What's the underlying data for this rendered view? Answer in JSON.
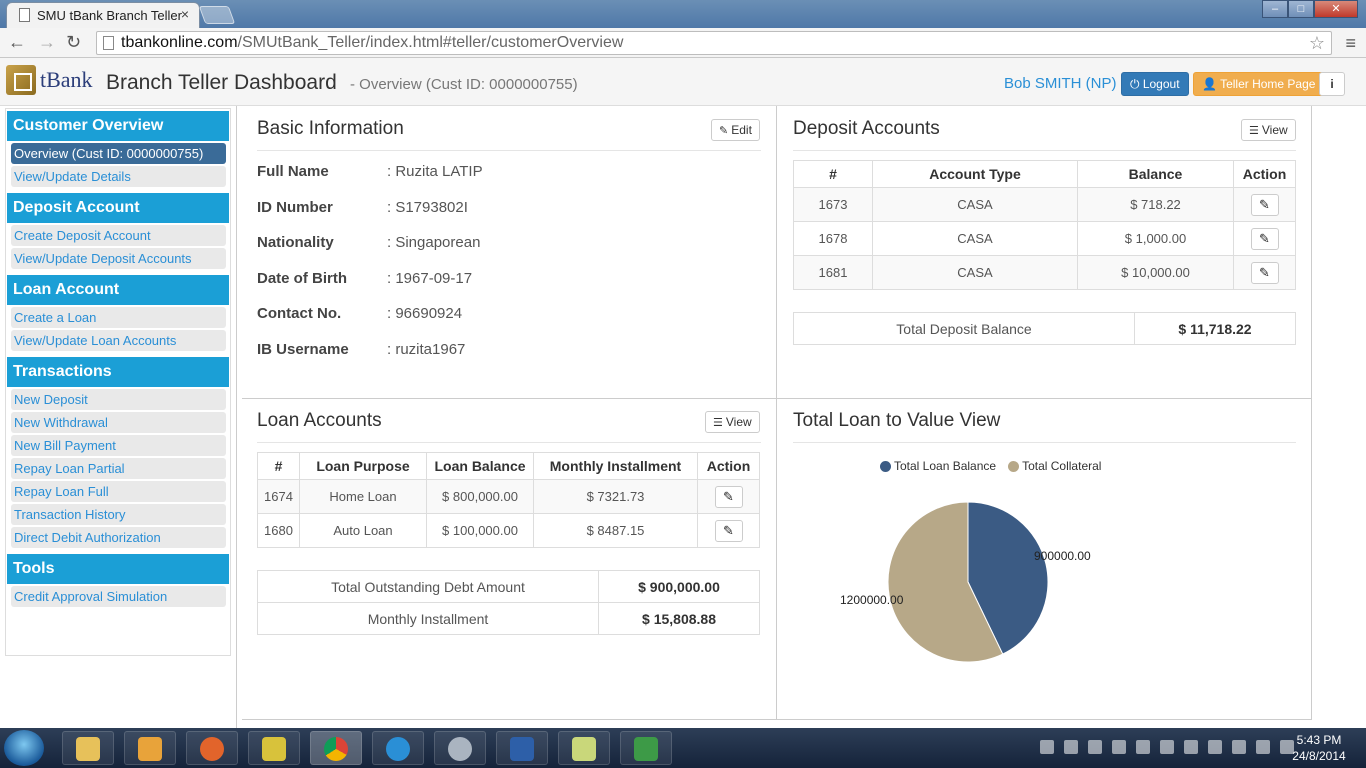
{
  "browser": {
    "tab_title": "SMU tBank Branch Teller",
    "tab_close": "×",
    "url_host": "tbankonline.com",
    "url_path": "/SMUtBank_Teller/index.html#teller/customerOverview"
  },
  "header": {
    "logo_text": "tBank",
    "title": "Branch Teller Dashboard",
    "subtitle": "-  Overview (Cust ID: 0000000755)",
    "user": "Bob SMITH (NP)",
    "logout_label": "Logout",
    "teller_home_label": "Teller Home Page",
    "info_label": "i"
  },
  "sidebar": {
    "sections": [
      {
        "title": "Customer Overview",
        "items": [
          "Overview (Cust ID: 0000000755)",
          "View/Update Details"
        ]
      },
      {
        "title": "Deposit Account",
        "items": [
          "Create Deposit Account",
          "View/Update Deposit Accounts"
        ]
      },
      {
        "title": "Loan Account",
        "items": [
          "Create a Loan",
          "View/Update Loan Accounts"
        ]
      },
      {
        "title": "Transactions",
        "items": [
          "New Deposit",
          "New Withdrawal",
          "New Bill Payment",
          "Repay Loan Partial",
          "Repay Loan Full",
          "Transaction History",
          "Direct Debit Authorization"
        ]
      },
      {
        "title": "Tools",
        "items": [
          "Credit Approval Simulation"
        ]
      }
    ]
  },
  "basic_info": {
    "title": "Basic Information",
    "edit_label": "Edit",
    "rows": [
      {
        "label": "Full Name",
        "value": ": Ruzita LATIP"
      },
      {
        "label": "ID Number",
        "value": ": S1793802I"
      },
      {
        "label": "Nationality",
        "value": ": Singaporean"
      },
      {
        "label": "Date of Birth",
        "value": ": 1967-09-17"
      },
      {
        "label": "Contact No.",
        "value": ": 96690924"
      },
      {
        "label": "IB Username",
        "value": ": ruzita1967"
      }
    ]
  },
  "deposit": {
    "title": "Deposit Accounts",
    "view_label": "View",
    "headers": [
      "#",
      "Account Type",
      "Balance",
      "Action"
    ],
    "rows": [
      {
        "id": "1673",
        "type": "CASA",
        "balance": "$ 718.22"
      },
      {
        "id": "1678",
        "type": "CASA",
        "balance": "$ 1,000.00"
      },
      {
        "id": "1681",
        "type": "CASA",
        "balance": "$ 10,000.00"
      }
    ],
    "total_label": "Total Deposit Balance",
    "total_value": "$ 11,718.22"
  },
  "loan": {
    "title": "Loan Accounts",
    "view_label": "View",
    "headers": [
      "#",
      "Loan Purpose",
      "Loan Balance",
      "Monthly Installment",
      "Action"
    ],
    "rows": [
      {
        "id": "1674",
        "purpose": "Home Loan",
        "balance": "$ 800,000.00",
        "installment": "$ 7321.73"
      },
      {
        "id": "1680",
        "purpose": "Auto Loan",
        "balance": "$ 100,000.00",
        "installment": "$ 8487.15"
      }
    ],
    "debt_label": "Total Outstanding Debt Amount",
    "debt_value": "$ 900,000.00",
    "monthly_label": "Monthly Installment",
    "monthly_value": "$ 15,808.88"
  },
  "ltv": {
    "title": "Total Loan to Value View"
  },
  "chart_data": {
    "type": "pie",
    "title": "",
    "legend_position": "top",
    "series": [
      {
        "name": "Total Loan Balance",
        "value": 900000,
        "label": "900000.00",
        "color": "#3b5b84"
      },
      {
        "name": "Total Collateral",
        "value": 1200000,
        "label": "1200000.00",
        "color": "#b7a888"
      }
    ]
  },
  "taskbar": {
    "time": "5:43 PM",
    "date": "24/8/2014"
  }
}
